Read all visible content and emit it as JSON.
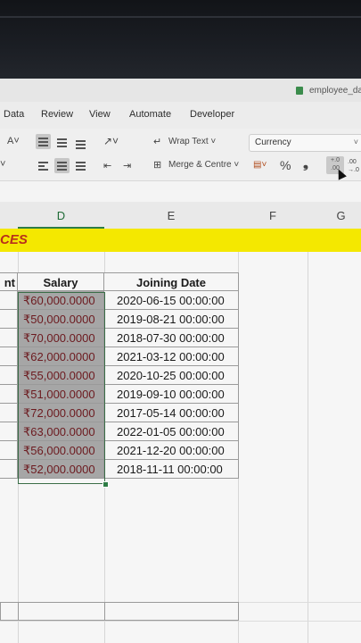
{
  "window": {
    "file_name": "employee_da"
  },
  "menu": [
    "Data",
    "Review",
    "View",
    "Automate",
    "Developer"
  ],
  "ribbon": {
    "font_size_label": "A˅",
    "wrap_text": "Wrap Text ˅",
    "merge_centre": "Merge & Centre ˅",
    "number_format": "Currency",
    "percent": "%",
    "comma": "❟",
    "decrease_decimal": ".00 →.0"
  },
  "columns": [
    "D",
    "E",
    "F",
    "G"
  ],
  "banner_text": "CES",
  "table": {
    "left_header": "nt",
    "headers": [
      "Salary",
      "Joining Date"
    ],
    "rows": [
      [
        "₹60,000.0000",
        "2020-06-15 00:00:00"
      ],
      [
        "₹50,000.0000",
        "2019-08-21 00:00:00"
      ],
      [
        "₹70,000.0000",
        "2018-07-30 00:00:00"
      ],
      [
        "₹62,000.0000",
        "2021-03-12 00:00:00"
      ],
      [
        "₹55,000.0000",
        "2020-10-25 00:00:00"
      ],
      [
        "₹51,000.0000",
        "2019-09-10 00:00:00"
      ],
      [
        "₹72,000.0000",
        "2017-05-14 00:00:00"
      ],
      [
        "₹63,000.0000",
        "2022-01-05 00:00:00"
      ],
      [
        "₹56,000.0000",
        "2021-12-20 00:00:00"
      ],
      [
        "₹52,000.0000",
        "2018-11-11 00:00:00"
      ]
    ]
  },
  "colors": {
    "banner": "#f4e800",
    "banner_text": "#b8301b",
    "salary_text": "#6c1a1f",
    "selection": "#2e7d46"
  }
}
